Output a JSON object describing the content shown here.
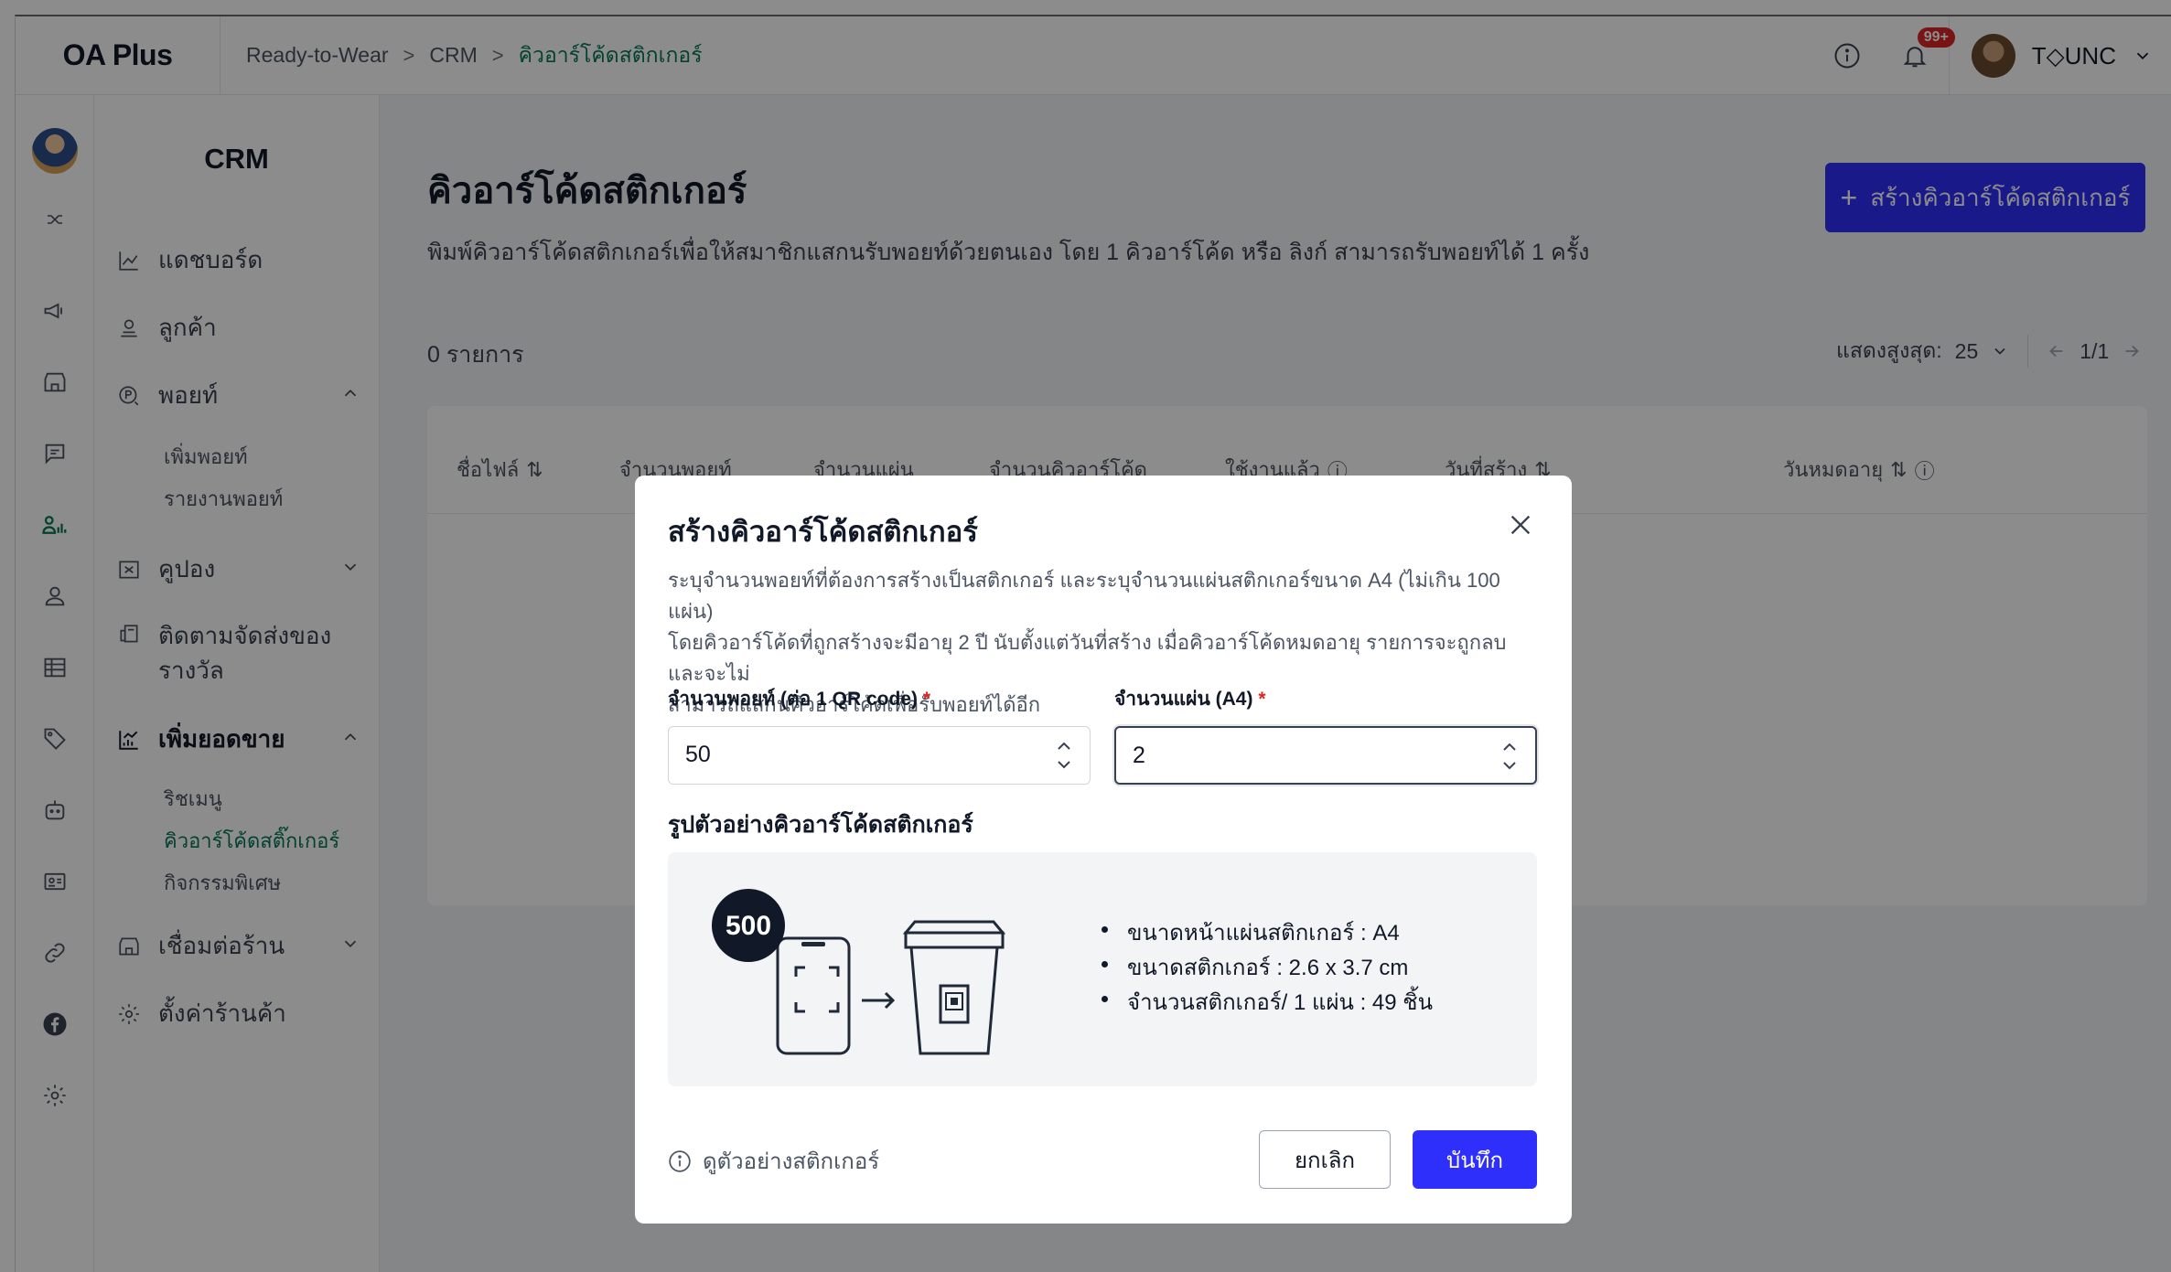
{
  "app": {
    "logo": "OA Plus"
  },
  "breadcrumb": {
    "items": [
      "Ready-to-Wear",
      "CRM"
    ],
    "current": "คิวอาร์โค้ดสติกเกอร์"
  },
  "header": {
    "notification_count": "99+",
    "user_name": "T◇UNC"
  },
  "sidebar": {
    "title": "CRM",
    "dashboard": "แดชบอร์ด",
    "customers": "ลูกค้า",
    "points": "พอยท์",
    "add_points": "เพิ่มพอยท์",
    "point_report": "รายงานพอยท์",
    "coupons": "คูปอง",
    "reward_tracking_line1": "ติดตามจัดส่งของ",
    "reward_tracking_line2": "รางวัล",
    "boost_sales": "เพิ่มยอดขาย",
    "rich_menu": "ริชเมนู",
    "qr_sticker": "คิวอาร์โค้ดสติ๊กเกอร์",
    "special_activity": "กิจกรรมพิเศษ",
    "connect_store": "เชื่อมต่อร้าน",
    "store_settings": "ตั้งค่าร้านค้า"
  },
  "main": {
    "title": "คิวอาร์โค้ดสติกเกอร์",
    "description": "พิมพ์คิวอาร์โค้ดสติกเกอร์เพื่อให้สมาชิกแสกนรับพอยท์ด้วยตนเอง โดย 1 คิวอาร์โค้ด หรือ ลิงก์ สามารถรับพอยท์ได้ 1 ครั้ง",
    "create_button": "สร้างคิวอาร์โค้ดสติกเกอร์",
    "record_count": "0 รายการ",
    "show_max_label": "แสดงสูงสุด:",
    "show_max_value": "25",
    "page_info": "1/1",
    "columns": [
      "ชื่อไฟล์",
      "จำนวนพอยท์",
      "จำนวนแผ่น",
      "จำนวนคิวอาร์โค้ด",
      "ใช้งานแล้ว",
      "วันที่สร้าง",
      "วันหมดอายุ"
    ]
  },
  "modal": {
    "title": "สร้างคิวอาร์โค้ดสติกเกอร์",
    "desc_line1": "ระบุจำนวนพอยท์ที่ต้องการสร้างเป็นสติกเกอร์ และระบุจำนวนแผ่นสติกเกอร์ขนาด A4 (ไม่เกิน 100 แผ่น)",
    "desc_line2": "โดยคิวอาร์โค้ดที่ถูกสร้างจะมีอายุ 2 ปี นับตั้งแต่วันที่สร้าง เมื่อคิวอาร์โค้ดหมดอายุ รายการจะถูกลบและจะไม่",
    "desc_line3": "สามารถแสกนคิวอาร์โค้ดเพื่อรับพอยท์ได้อีก",
    "points_label": "จำนวนพอยท์ (ต่อ 1 QR code)",
    "points_value": "50",
    "sheets_label": "จำนวนแผ่น (A4)",
    "sheets_value": "2",
    "required_mark": "*",
    "example_title": "รูปตัวอย่างคิวอาร์โค้ดสติกเกอร์",
    "example_points": "500",
    "spec_items": [
      "ขนาดหน้าแผ่นสติกเกอร์ : A4",
      "ขนาดสติกเกอร์ : 2.6 x 3.7 cm",
      "จำนวนสติกเกอร์/ 1 แผ่น : 49 ชิ้น"
    ],
    "preview_link": "ดูตัวอย่างสติกเกอร์",
    "cancel": "ยกเลิก",
    "save": "บันทึก"
  },
  "colors": {
    "primary": "#2f2ffb",
    "active_green": "#047857",
    "badge_red": "#dc2626",
    "overlay": "rgba(0,0,0,0.45)"
  }
}
